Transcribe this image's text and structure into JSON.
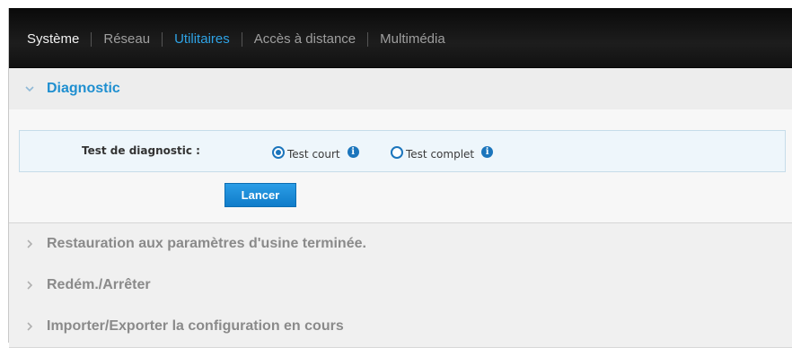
{
  "nav": {
    "items": [
      {
        "label": "Système"
      },
      {
        "label": "Réseau"
      },
      {
        "label": "Utilitaires"
      },
      {
        "label": "Accès à distance"
      },
      {
        "label": "Multimédia"
      }
    ]
  },
  "sections": {
    "diagnostic": {
      "title": "Diagnostic",
      "field_label": "Test de diagnostic :",
      "options": [
        {
          "label": "Test court",
          "selected": true
        },
        {
          "label": "Test complet",
          "selected": false
        }
      ],
      "launch_label": "Lancer"
    },
    "restore": {
      "title": "Restauration aux paramètres d'usine terminée."
    },
    "reboot": {
      "title": "Redém./Arrêter"
    },
    "import_export": {
      "title": "Importer/Exporter la configuration en cours"
    }
  },
  "colors": {
    "accent": "#1f8fd0",
    "nav_bg": "#111111",
    "button": "#1b7fcc"
  }
}
